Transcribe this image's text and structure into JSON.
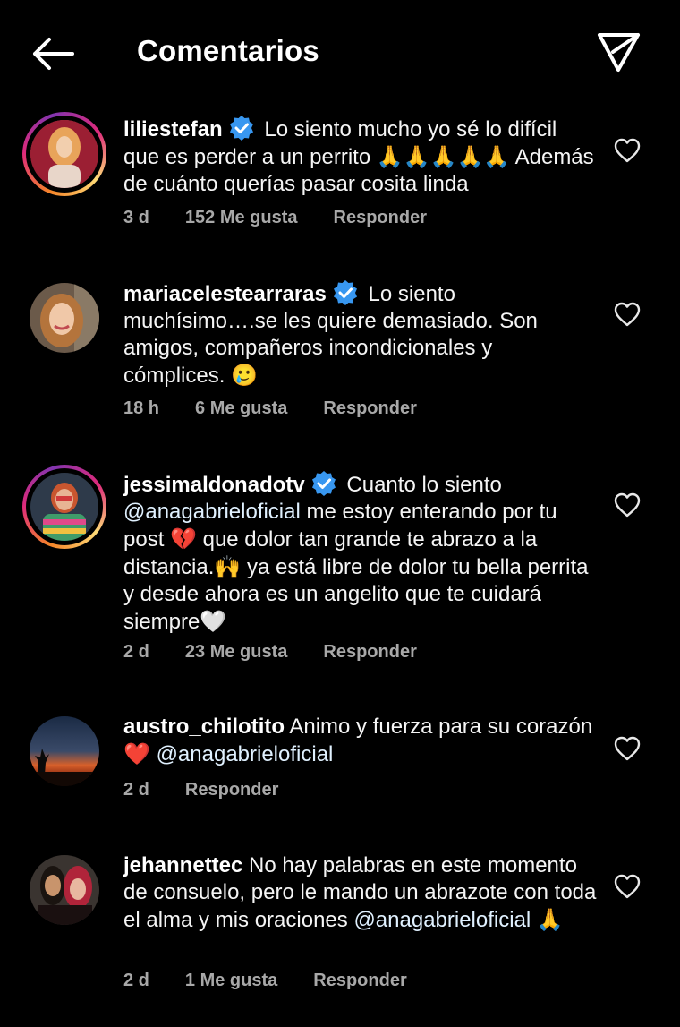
{
  "header": {
    "title": "Comentarios"
  },
  "comments": [
    {
      "username": "liliestefan",
      "verified": true,
      "text_a": "Lo siento mucho yo sé lo difícil que es perder a un perrito ",
      "emoji_a": "🙏🙏🙏🙏🙏",
      "text_b": " Además de cuánto querías pasar cosita linda",
      "time": "3 d",
      "likes": "152 Me gusta",
      "reply": "Responder"
    },
    {
      "username": "mariacelestearraras",
      "verified": true,
      "text_a": "Lo siento muchísimo….se les quiere demasiado. Son amigos, compañeros incondicionales y cómplices. ",
      "emoji_a": "🥲",
      "time": "18 h",
      "likes": "6 Me gusta",
      "reply": "Responder"
    },
    {
      "username": "jessimaldonadotv",
      "verified": true,
      "text_a": "Cuanto lo siento ",
      "mention": "@anagabrieloficial",
      "text_b": " me estoy enterando por tu post ",
      "emoji_b": "💔",
      "text_c": " que dolor tan grande te abrazo a la distancia.",
      "emoji_c": "🙌",
      "text_d": " ya está libre de dolor tu bella perrita y desde ahora es un angelito que te cuidará siempre",
      "emoji_d": "🤍",
      "time": "2 d",
      "likes": "23 Me gusta",
      "reply": "Responder"
    },
    {
      "username": "austro_chilotito",
      "verified": false,
      "text_a": " Animo y fuerza para su corazón ",
      "emoji_a": "❤️",
      "mention": "@anagabrieloficial",
      "time": "2 d",
      "reply": "Responder"
    },
    {
      "username": "jehannettec",
      "verified": false,
      "text_a": " No hay palabras en este momento  de consuelo,  pero le mando un abrazote con toda el alma y mis oraciones ",
      "mention": "@anagabrieloficial",
      "emoji_a": "🙏",
      "time": "2 d",
      "likes": "1 Me gusta",
      "reply": "Responder"
    }
  ],
  "colors": {
    "background": "#000000",
    "text": "#f5f5f5",
    "meta": "#a8a8a8",
    "verified": "#3897f0",
    "story_ring": [
      "#f58529",
      "#dd2a7b",
      "#8134af"
    ]
  },
  "icons": [
    "back-arrow-icon",
    "send-icon",
    "verified-badge-icon",
    "heart-icon"
  ]
}
